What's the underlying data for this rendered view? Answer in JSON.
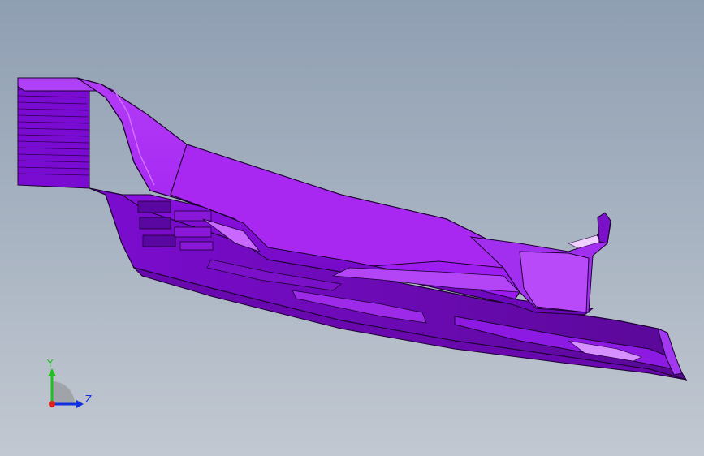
{
  "viewport": {
    "background_top": "#8f9fb2",
    "background_bottom": "#c2c8d1",
    "model_color": "#a020f0",
    "model_highlight": "#c04bff",
    "model_shadow": "#5a0a9a",
    "edge_color": "#1a0030"
  },
  "triad": {
    "y_label": "Y",
    "z_label": "Z",
    "y_color": "#20c020",
    "z_color": "#1030e0",
    "x_color": "#e02020"
  }
}
